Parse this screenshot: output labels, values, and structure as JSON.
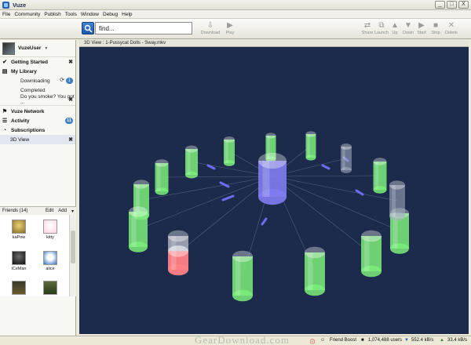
{
  "window": {
    "title": "Vuze",
    "min": "_",
    "max": "□",
    "close": "X"
  },
  "menu": [
    "File",
    "Community",
    "Publish",
    "Tools",
    "Window",
    "Debug",
    "Help"
  ],
  "search": {
    "value": "find..."
  },
  "toolbar": {
    "download": "Download",
    "play": "Play",
    "actions": [
      "Share",
      "Launch",
      "Up",
      "Down",
      "Start",
      "Stop",
      "Delete"
    ]
  },
  "sidebar": {
    "user": "VuzeUser",
    "getting_started": "Getting Started",
    "my_library": "My Library",
    "downloading": "Downloading",
    "downloading_count": "1",
    "completed": "Completed",
    "do_you_smoke": "Do you smoke? You got ...",
    "vuze_network": "Vuze Network",
    "activity": "Activity",
    "activity_count": "11",
    "subscriptions": "Subscriptions",
    "view_3d": "3D View"
  },
  "friends": {
    "header": "Friends (14)",
    "edit": "Edit",
    "add": "Add",
    "list": [
      "kaPow",
      "kitty",
      "iCeMan",
      "alice"
    ]
  },
  "view": {
    "tab_title": "3D View : 1-Pussycat Dolls - Sway.mkv"
  },
  "status": {
    "friend_boost": "Friend Boost",
    "users": "1,074,488 users",
    "down_speed": "552.4 kB/s",
    "up_speed": "33.4 kB/s"
  },
  "watermark": "GearDownload.com",
  "peer_colors": {
    "center": "#7f7cf2",
    "seed": "#7bef7b",
    "stalled": "#aab3c4",
    "red": "#ff7f84"
  }
}
